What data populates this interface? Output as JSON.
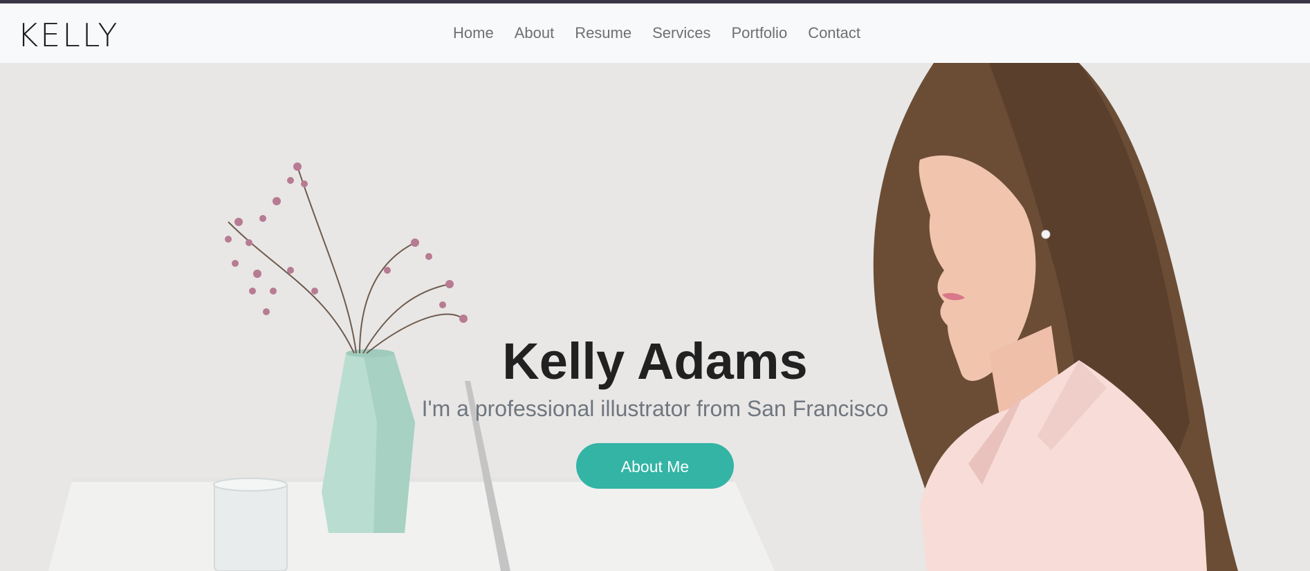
{
  "header": {
    "logo": "KELLY",
    "nav": [
      {
        "label": "Home"
      },
      {
        "label": "About"
      },
      {
        "label": "Resume"
      },
      {
        "label": "Services"
      },
      {
        "label": "Portfolio"
      },
      {
        "label": "Contact"
      }
    ]
  },
  "hero": {
    "title": "Kelly Adams",
    "subtitle": "I'm a professional illustrator from San Francisco",
    "button_label": "About Me"
  },
  "colors": {
    "accent": "#33b4a5",
    "topbar": "#3b3646",
    "header_bg": "#f8f9fb",
    "nav_text": "#6f6f6f",
    "title_text": "#212121",
    "subtitle_text": "#6f767f"
  }
}
